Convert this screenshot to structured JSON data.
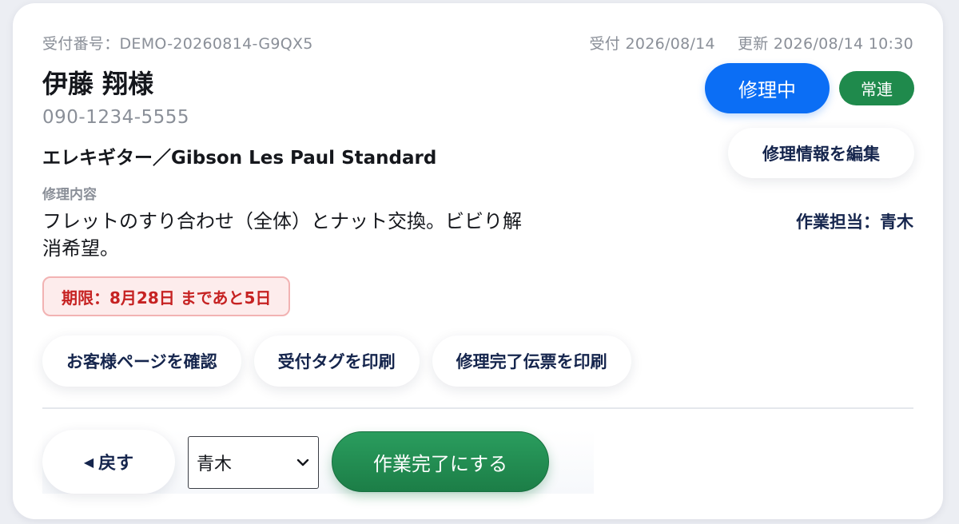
{
  "header": {
    "receipt_number": "受付番号：DEMO-20260814-G9QX5",
    "received": "受付 2026/08/14",
    "updated": "更新 2026/08/14 10:30"
  },
  "customer": {
    "name": "伊藤 翔様",
    "phone": "090-1234-5555"
  },
  "instrument": "エレキギター／Gibson Les Paul Standard",
  "repair": {
    "section_label": "修理内容",
    "description": "フレットのすり合わせ（全体）とナット交換。ビビり解消希望。"
  },
  "deadline": "期限：8月28日 まであと5日",
  "status": {
    "label": "修理中",
    "color": "#0b6ef5"
  },
  "regular_badge": {
    "label": "常連",
    "color": "#1f8a4c"
  },
  "edit_button": "修理情報を編集",
  "worker": "作業担当：青木",
  "actions": {
    "customer_page": "お客様ページを確認",
    "print_tag": "受付タグを印刷",
    "print_slip": "修理完了伝票を印刷"
  },
  "footer": {
    "back_icon": "left-triangle-icon",
    "back_label": "戻す",
    "assignee_selected": "青木",
    "complete_label": "作業完了にする",
    "complete_color": "#1f8a4c"
  }
}
